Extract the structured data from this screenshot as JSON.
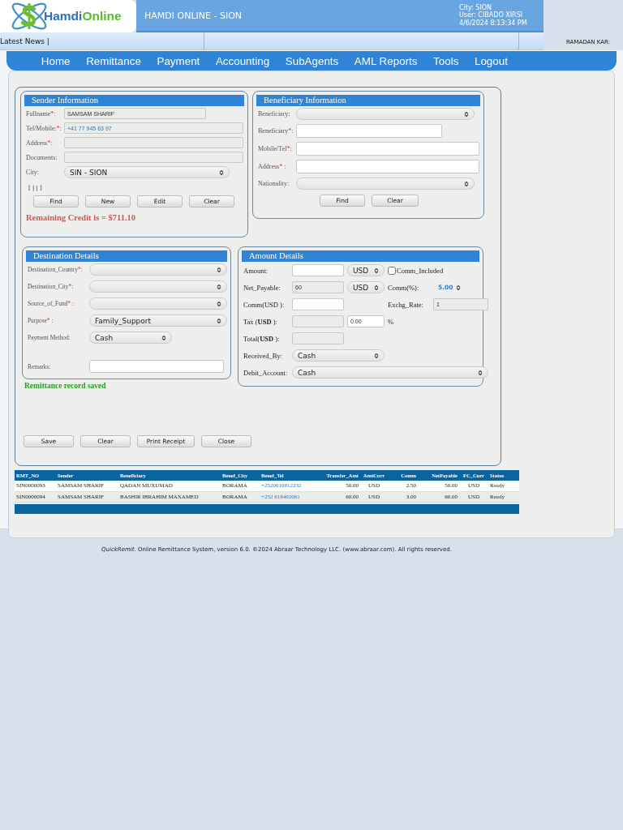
{
  "header": {
    "brand_first": "Hamdi",
    "brand_second": "Online",
    "title": "HAMDI ONLINE - SION",
    "info": [
      "City: SION",
      "User: CIBADO XIRSI",
      "4/6/2024 8:13:34 PM"
    ]
  },
  "news": {
    "label": "Latest News |",
    "ticker": "RAMADAN KAR:"
  },
  "nav": [
    "Home",
    "Remittance",
    "Payment",
    "Accounting",
    "SubAgents",
    "AML Reports",
    "Tools",
    "Logout"
  ],
  "sender": {
    "title": "Sender Information",
    "fields": [
      {
        "kind": "input",
        "label": "Fullname",
        "mark": "*",
        "after": ":",
        "value": "SAMSAM SHARIF",
        "disabled": true
      },
      {
        "kind": "input",
        "label": "Tel/Mobile:",
        "mark": "*",
        "after": ":",
        "value": "+41 77 945 63 97",
        "disabled": true
      },
      {
        "kind": "input",
        "label": "Address",
        "mark": "*",
        "after": ":",
        "disabled": true
      },
      {
        "kind": "input",
        "label": "Documents:",
        "disabled": true
      },
      {
        "kind": "select",
        "label": "City:",
        "value": "SIN - SION"
      }
    ],
    "note": "[ | | ]",
    "buttons": [
      "Find",
      "New",
      "Edit",
      "Clear"
    ],
    "credit": "Remaining Credit is = $711.10"
  },
  "beneficiary": {
    "title": "Beneficiary Information",
    "fields": [
      {
        "kind": "select",
        "label": "Beneficiary:"
      },
      {
        "kind": "input",
        "label": "Beneficiary",
        "mark": "*",
        "after": ":",
        "disabled": false
      },
      {
        "kind": "input",
        "label": "Mobile/Tel",
        "mark": "*",
        "after": ":",
        "disabled": false
      },
      {
        "kind": "input",
        "label": "Address",
        "mark": "*",
        "after": " :",
        "disabled": false
      },
      {
        "kind": "select",
        "label": "Nationality:"
      }
    ],
    "buttons": [
      "Find",
      "Clear"
    ]
  },
  "destination": {
    "title": "Destination Details",
    "fields": [
      {
        "kind": "select",
        "label": "Destination_Country",
        "mark": "*",
        "after": ":"
      },
      {
        "kind": "select",
        "label": "Destination_City",
        "mark": "*",
        "after": ":"
      },
      {
        "kind": "select",
        "label": "Source_of_Fund",
        "mark": "*",
        "after": " :"
      },
      {
        "kind": "select",
        "label": "Purpose",
        "mark": "*",
        "after": " :",
        "value": "Family_Support"
      },
      {
        "kind": "select",
        "label": "Payment Method:",
        "value": "Cash"
      },
      {
        "kind": "input",
        "label": "Remarks:",
        "disabled": false
      }
    ]
  },
  "amount": {
    "title": "Amount Details",
    "rows": [
      [
        {
          "kind": "label",
          "text": "Amount:"
        },
        {
          "kind": "input",
          "disabled": false
        },
        {
          "kind": "select",
          "value": "USD"
        },
        {
          "kind": "checkbox",
          "text": "Comm_Included",
          "checked": false
        }
      ],
      [
        {
          "kind": "label",
          "text": "Net_Payable:"
        },
        {
          "kind": "input",
          "value": "60",
          "disabled": true
        },
        {
          "kind": "select",
          "value": "USD"
        },
        {
          "kind": "label",
          "text": "Comm(%):"
        },
        {
          "kind": "select",
          "value": "5.00"
        }
      ],
      [
        {
          "kind": "label",
          "text": "Comm(USD ):"
        },
        {
          "kind": "input",
          "disabled": false
        },
        "",
        {
          "kind": "label",
          "text": "Exchg_Rate:"
        },
        {
          "kind": "input",
          "value": "1",
          "disabled": true
        }
      ],
      [
        {
          "kind": "label",
          "text": "Tax (**USD** ):"
        },
        {
          "kind": "input",
          "disabled": true
        },
        {
          "kind": "input",
          "value": "0.00",
          "disabled": false
        },
        {
          "kind": "label",
          "text": "%"
        }
      ],
      [
        {
          "kind": "label",
          "text": "Total(**USD** ):"
        },
        {
          "kind": "input",
          "disabled": true
        }
      ],
      [
        {
          "kind": "label",
          "text": "Received_By:"
        },
        {
          "kind": "select",
          "value": "Cash"
        }
      ],
      [
        {
          "kind": "label",
          "text": "Debit_Account:"
        },
        {
          "kind": "select",
          "value": "Cash"
        }
      ]
    ]
  },
  "message": "Remittance record saved",
  "actions": [
    "Save",
    "Clear",
    "Print Receipt",
    "Close"
  ],
  "table": {
    "columns": [
      "RMT_NO",
      "Sender",
      "Beneficiary",
      "Benef_City",
      "Benef_Tel",
      "Transfer_Amt",
      "AmtCurr",
      "Comm",
      "NetPayable",
      "FC_Curr",
      "Status"
    ],
    "rows": [
      [
        "SIN0000093",
        "SAMSAM SHARIF",
        "QADAN MUXUMAD",
        "BORAMA",
        "+2520616812232",
        "50.00",
        "USD",
        "2.50",
        "50.00",
        "USD",
        "Ready"
      ],
      [
        "SIN0000094",
        "SAMSAM SHARIF",
        "BASHIR IBRAHIM MAXAMED",
        "BORAMA",
        "+252 618402061",
        "60.00",
        "USD",
        "3.00",
        "60.00",
        "USD",
        "Ready"
      ]
    ]
  },
  "footer": "*QuickRemit*. Online Remittance System, version 6.0. ©2024 Abraar Technology LLC. (www.abraar.com). All rights reserved."
}
